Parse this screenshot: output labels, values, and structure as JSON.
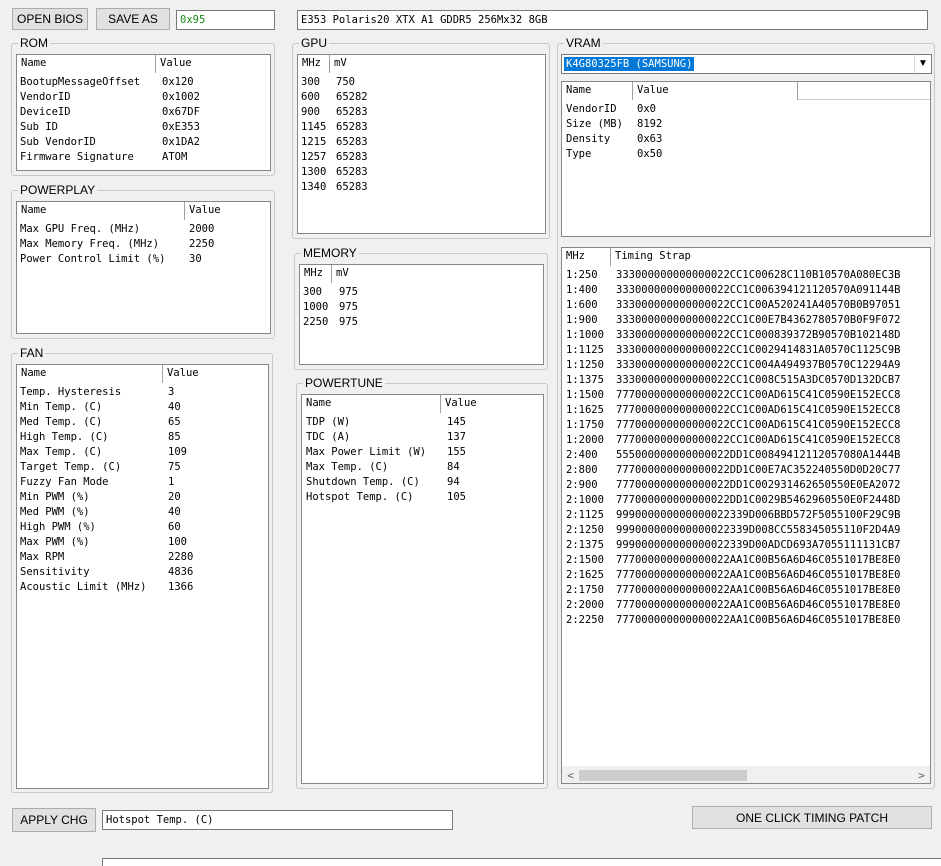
{
  "toolbar": {
    "open_bios_label": "OPEN BIOS",
    "save_as_label": "SAVE AS",
    "checksum": "0x95",
    "bios_info": "E353 Polaris20 XTX A1 GDDR5 256Mx32 8GB"
  },
  "rom": {
    "title": "ROM",
    "col_name": "Name",
    "col_value": "Value",
    "rows": [
      {
        "name": "BootupMessageOffset",
        "value": "0x120"
      },
      {
        "name": "VendorID",
        "value": "0x1002"
      },
      {
        "name": "DeviceID",
        "value": "0x67DF"
      },
      {
        "name": "Sub ID",
        "value": "0xE353"
      },
      {
        "name": "Sub VendorID",
        "value": "0x1DA2"
      },
      {
        "name": "Firmware Signature",
        "value": "ATOM"
      }
    ]
  },
  "powerplay": {
    "title": "POWERPLAY",
    "col_name": "Name",
    "col_value": "Value",
    "rows": [
      {
        "name": "Max GPU Freq. (MHz)",
        "value": "2000"
      },
      {
        "name": "Max Memory Freq. (MHz)",
        "value": "2250"
      },
      {
        "name": "Power Control Limit (%)",
        "value": "30"
      }
    ]
  },
  "fan": {
    "title": "FAN",
    "col_name": "Name",
    "col_value": "Value",
    "rows": [
      {
        "name": "Temp. Hysteresis",
        "value": "3"
      },
      {
        "name": "Min Temp. (C)",
        "value": "40"
      },
      {
        "name": "Med Temp. (C)",
        "value": "65"
      },
      {
        "name": "High Temp. (C)",
        "value": "85"
      },
      {
        "name": "Max Temp. (C)",
        "value": "109"
      },
      {
        "name": "Target Temp. (C)",
        "value": "75"
      },
      {
        "name": "Fuzzy Fan Mode",
        "value": "1"
      },
      {
        "name": "Min PWM (%)",
        "value": "20"
      },
      {
        "name": "Med PWM (%)",
        "value": "40"
      },
      {
        "name": "High PWM (%)",
        "value": "60"
      },
      {
        "name": "Max PWM (%)",
        "value": "100"
      },
      {
        "name": "Max RPM",
        "value": "2280"
      },
      {
        "name": "Sensitivity",
        "value": "4836"
      },
      {
        "name": "Acoustic Limit (MHz)",
        "value": "1366"
      }
    ]
  },
  "gpu": {
    "title": "GPU",
    "col_mhz": "MHz",
    "col_mv": "mV",
    "rows": [
      {
        "mhz": "300",
        "mv": "750"
      },
      {
        "mhz": "600",
        "mv": "65282"
      },
      {
        "mhz": "900",
        "mv": "65283"
      },
      {
        "mhz": "1145",
        "mv": "65283"
      },
      {
        "mhz": "1215",
        "mv": "65283"
      },
      {
        "mhz": "1257",
        "mv": "65283"
      },
      {
        "mhz": "1300",
        "mv": "65283"
      },
      {
        "mhz": "1340",
        "mv": "65283"
      }
    ]
  },
  "memory": {
    "title": "MEMORY",
    "col_mhz": "MHz",
    "col_mv": "mV",
    "rows": [
      {
        "mhz": "300",
        "mv": "975"
      },
      {
        "mhz": "1000",
        "mv": "975"
      },
      {
        "mhz": "2250",
        "mv": "975"
      }
    ]
  },
  "powertune": {
    "title": "POWERTUNE",
    "col_name": "Name",
    "col_value": "Value",
    "rows": [
      {
        "name": "TDP (W)",
        "value": "145"
      },
      {
        "name": "TDC (A)",
        "value": "137"
      },
      {
        "name": "Max Power Limit (W)",
        "value": "155"
      },
      {
        "name": "Max Temp. (C)",
        "value": "84"
      },
      {
        "name": "Shutdown Temp. (C)",
        "value": "94"
      },
      {
        "name": "Hotspot Temp. (C)",
        "value": "105"
      }
    ]
  },
  "vram": {
    "title": "VRAM",
    "selected": "K4G80325FB (SAMSUNG)",
    "col_name": "Name",
    "col_value": "Value",
    "rows": [
      {
        "name": "VendorID",
        "value": "0x0"
      },
      {
        "name": "Size (MB)",
        "value": "8192"
      },
      {
        "name": "Density",
        "value": "0x63"
      },
      {
        "name": "Type",
        "value": "0x50"
      }
    ]
  },
  "timing": {
    "col_mhz": "MHz",
    "col_strap": "Timing Strap",
    "rows": [
      {
        "mhz": "1:250",
        "strap": "333000000000000022CC1C00628C110B10570A080EC3B"
      },
      {
        "mhz": "1:400",
        "strap": "333000000000000022CC1C006394121120570A091144B"
      },
      {
        "mhz": "1:600",
        "strap": "333000000000000022CC1C00A520241A40570B0B97051"
      },
      {
        "mhz": "1:900",
        "strap": "333000000000000022CC1C00E7B4362780570B0F9F072"
      },
      {
        "mhz": "1:1000",
        "strap": "333000000000000022CC1C000839372B90570B102148D"
      },
      {
        "mhz": "1:1125",
        "strap": "333000000000000022CC1C0029414831A0570C1125C9B"
      },
      {
        "mhz": "1:1250",
        "strap": "333000000000000022CC1C004A494937B0570C12294A9"
      },
      {
        "mhz": "1:1375",
        "strap": "333000000000000022CC1C008C515A3DC0570D132DCB7"
      },
      {
        "mhz": "1:1500",
        "strap": "777000000000000022CC1C00AD615C41C0590E152ECC8"
      },
      {
        "mhz": "1:1625",
        "strap": "777000000000000022CC1C00AD615C41C0590E152ECC8"
      },
      {
        "mhz": "1:1750",
        "strap": "777000000000000022CC1C00AD615C41C0590E152ECC8"
      },
      {
        "mhz": "1:2000",
        "strap": "777000000000000022CC1C00AD615C41C0590E152ECC8"
      },
      {
        "mhz": "2:400",
        "strap": "555000000000000022DD1C00849412112057080A1444B"
      },
      {
        "mhz": "2:800",
        "strap": "777000000000000022DD1C00E7AC352240550D0D20C77"
      },
      {
        "mhz": "2:900",
        "strap": "777000000000000022DD1C002931462650550E0EA2072"
      },
      {
        "mhz": "2:1000",
        "strap": "777000000000000022DD1C0029B5462960550E0F2448D"
      },
      {
        "mhz": "2:1125",
        "strap": "999000000000000022339D006BBD572F5055100F29C9B"
      },
      {
        "mhz": "2:1250",
        "strap": "999000000000000022339D008CC558345055110F2D4A9"
      },
      {
        "mhz": "2:1375",
        "strap": "999000000000000022339D00ADCD693A7055111131CB7"
      },
      {
        "mhz": "2:1500",
        "strap": "777000000000000022AA1C00B56A6D46C0551017BE8E0"
      },
      {
        "mhz": "2:1625",
        "strap": "777000000000000022AA1C00B56A6D46C0551017BE8E0"
      },
      {
        "mhz": "2:1750",
        "strap": "777000000000000022AA1C00B56A6D46C0551017BE8E0"
      },
      {
        "mhz": "2:2000",
        "strap": "777000000000000022AA1C00B56A6D46C0551017BE8E0"
      },
      {
        "mhz": "2:2250",
        "strap": "777000000000000022AA1C00B56A6D46C0551017BE8E0"
      }
    ]
  },
  "bottom": {
    "apply_label": "APPLY CHG",
    "edit_value": "Hotspot Temp. (C)",
    "timing_patch_label": "ONE CLICK TIMING PATCH"
  },
  "icons": {
    "dropdown": "chevron-down-icon",
    "scroll_left": "arrow-left-icon",
    "scroll_right": "arrow-right-icon"
  }
}
